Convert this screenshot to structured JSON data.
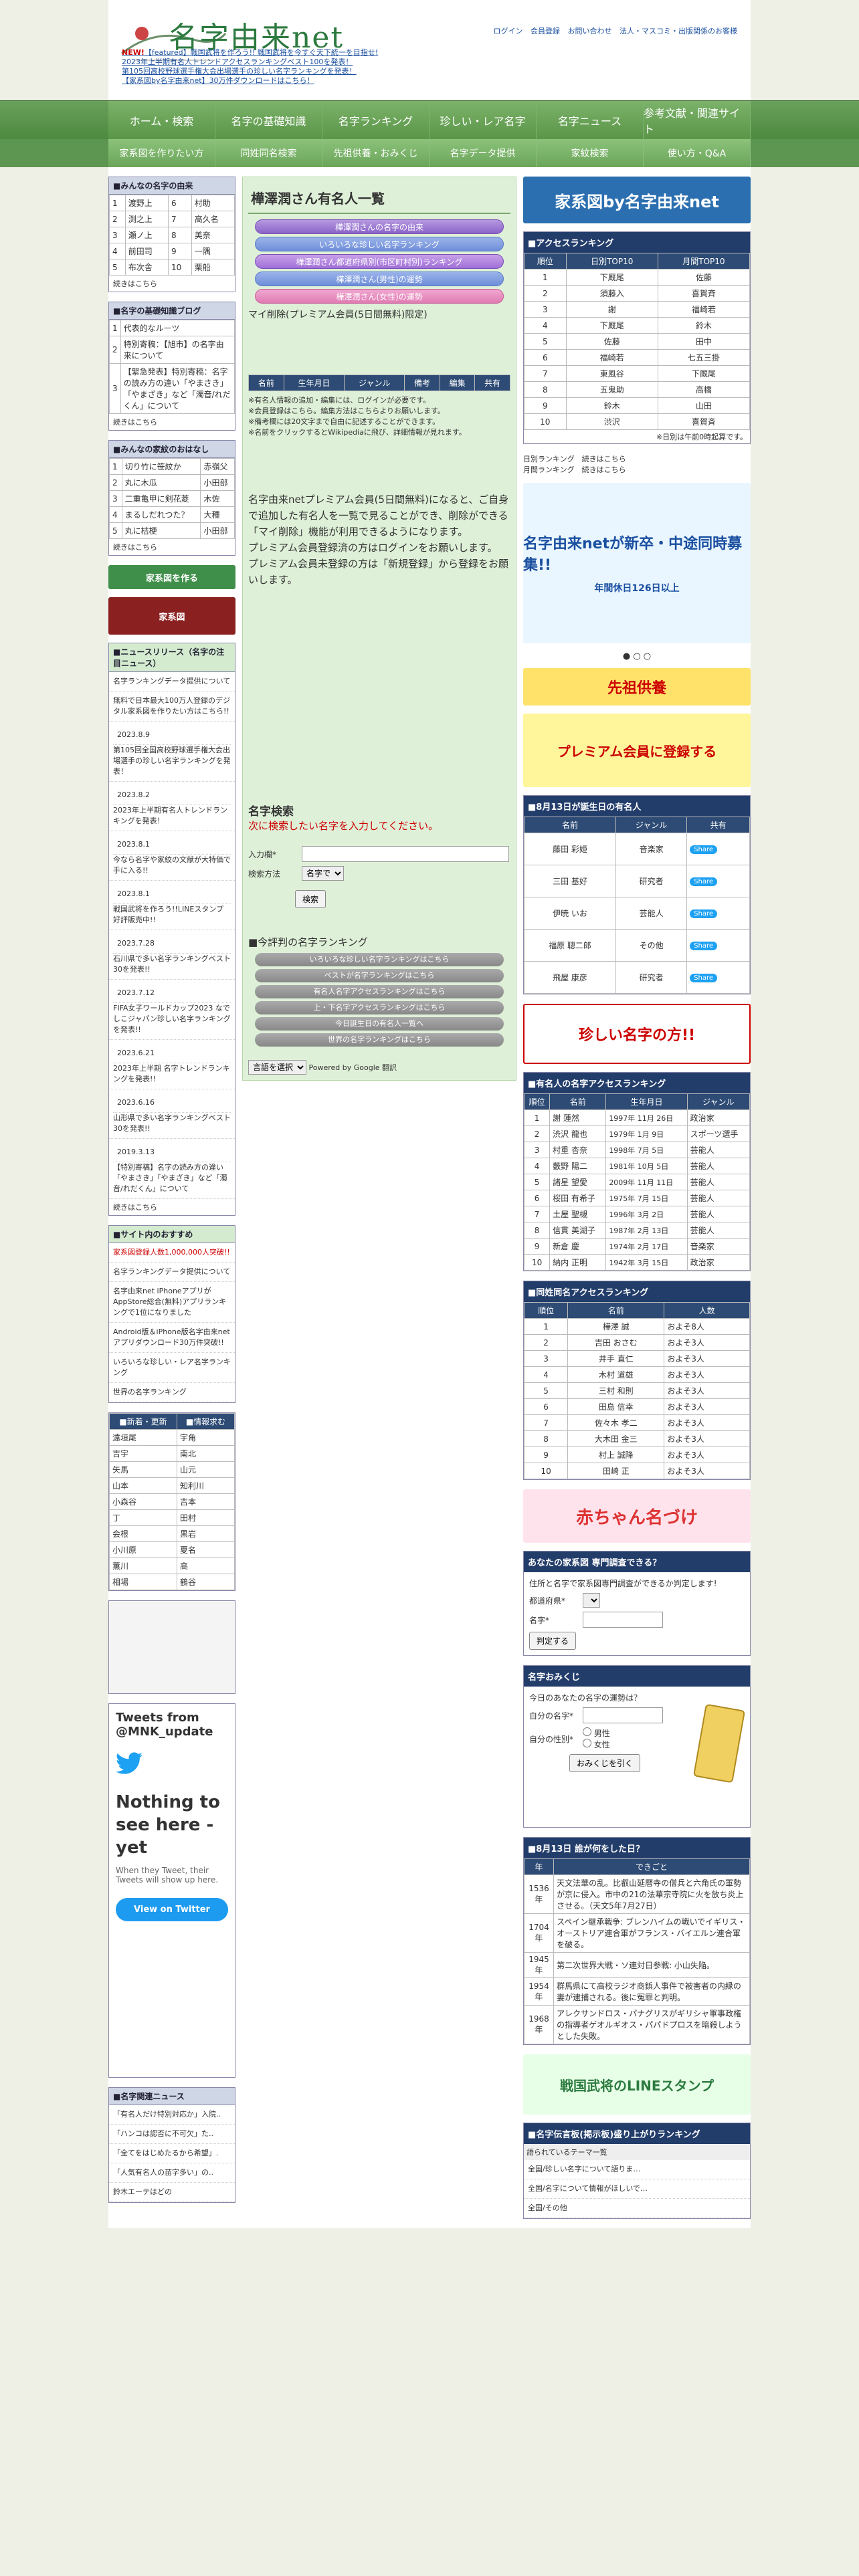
{
  "header": {
    "logo": "名字由来net",
    "links": [
      "ログイン",
      "会員登録",
      "お問い合わせ",
      "法人・マスコミ・出版関係のお客様"
    ],
    "news": [
      {
        "new": "NEW!",
        "text": "【featured】戦国武将を作ろう!! 戦国武将を今すぐ天下統一を目指せ!"
      },
      {
        "new": "",
        "text": "2023年上半期有名人トレンドアクセスランキングベスト100を発表！"
      },
      {
        "new": "",
        "text": "第105回高校野球選手権大会出場選手の珍しい名字ランキングを発表！"
      },
      {
        "new": "",
        "text": "【家系図by名字由来net】30万件ダウンロードはこちら！"
      }
    ]
  },
  "nav": [
    "ホーム・検索",
    "名字の基礎知識",
    "名字ランキング",
    "珍しい・レア名字",
    "名字ニュース",
    "参考文献・関連サイト"
  ],
  "subnav": [
    "家系図を作りたい方",
    "同姓同名検索",
    "先祖供養・おみくじ",
    "名字データ提供",
    "家紋検索",
    "使い方・Q&A"
  ],
  "left": {
    "surname_box_title": "■みんなの名字の由来",
    "surnames": [
      [
        "1",
        "渡野上",
        "6",
        "村助"
      ],
      [
        "2",
        "渕之上",
        "7",
        "高久名"
      ],
      [
        "3",
        "瀬ノ上",
        "8",
        "美奈"
      ],
      [
        "4",
        "前田司",
        "9",
        "一隅"
      ],
      [
        "5",
        "布次舎",
        "10",
        "栗船"
      ]
    ],
    "more": "続きはこちら",
    "basics_title": "■名字の基礎知識ブログ",
    "basics": [
      [
        "1",
        "代表的なルーツ"
      ],
      [
        "2",
        "特別寄稿：【旭市】の名字由来について"
      ],
      [
        "3",
        "【緊急発表】特別寄稿：名字の読み方の違い「やまさき」「やまざき」など「濁音/れだくん」について"
      ]
    ],
    "kamon_title": "■みんなの家紋のおはなし",
    "kamon": [
      [
        "1",
        "切り竹に笹紋か",
        "赤嶺父"
      ],
      [
        "2",
        "丸に木瓜",
        "小田部"
      ],
      [
        "3",
        "二重亀甲に剣花菱",
        "木佐"
      ],
      [
        "4",
        "まるしだれつた？",
        "大種"
      ],
      [
        "5",
        "丸に桔梗",
        "小田部"
      ]
    ],
    "news_title": "■ニュースリリース（名字の注目ニュース）",
    "news_items": [
      {
        "date": "",
        "text": "名字ランキングデータ提供について"
      },
      {
        "date": "",
        "text": "無料で日本最大100万人登録のデジタル家系図を作りたい方はこちら!!"
      },
      {
        "date": "2023.8.9",
        "text": "第105回全国高校野球選手権大会出場選手の珍しい名字ランキングを発表！"
      },
      {
        "date": "2023.8.2",
        "text": "2023年上半期有名人トレンドランキングを発表！"
      },
      {
        "date": "2023.8.1",
        "text": "今なら名字や家紋の文献が大特価で手に入る!!"
      },
      {
        "date": "2023.8.1",
        "text": "戦国武将を作ろう!!LINEスタンプ　好評販売中!!"
      },
      {
        "date": "2023.7.28",
        "text": "石川県で多い名字ランキングベスト30を発表!!"
      },
      {
        "date": "2023.7.12",
        "text": "FIFA女子ワールドカップ2023 なでしこジャパン珍しい名字ランキングを発表!!"
      },
      {
        "date": "2023.6.21",
        "text": "2023年上半期 名字トレンドランキングを発表!!"
      },
      {
        "date": "2023.6.16",
        "text": "山形県で多い名字ランキングベスト30を発表!!"
      },
      {
        "date": "2019.3.13",
        "text": "【特別寄稿】名字の読み方の違い「やまさき」「やまざき」など「濁音/れだくん」について"
      }
    ],
    "site_title": "■サイト内のおすすめ",
    "site_items": [
      "家系図登録人数1,000,000人突破!!",
      "名字ランキングデータ提供について",
      "名字由来net iPhoneアプリがAppStore総合(無料)アプリランキングで1位になりました",
      "Android版＆iPhone版名字由来netアプリダウンロード30万件突破!!",
      "いろいろな珍しい・レア名字ランキング",
      "世界の名字ランキング"
    ],
    "new_title1": "■新着・更新",
    "new_title2": "■情報求む",
    "new_rows": [
      [
        "遠垣尾",
        "宇角"
      ],
      [
        "吉宇",
        "南北"
      ],
      [
        "矢馬",
        "山元"
      ],
      [
        "山本",
        "知利川"
      ],
      [
        "小森谷",
        "吉本"
      ],
      [
        "丁",
        "田村"
      ],
      [
        "会根",
        "黒岩"
      ],
      [
        "小川原",
        "夏名"
      ],
      [
        "薫川",
        "高"
      ],
      [
        "相場",
        "鶴谷"
      ]
    ],
    "twitter_title": "Tweets from @MNK_update",
    "twitter_empty": "Nothing to see here - yet",
    "twitter_sub": "When they Tweet, their Tweets will show up here.",
    "twitter_btn": "View on Twitter",
    "related_title": "■名字関連ニュース",
    "related": [
      "「有名人だけ特別対応か」入院..",
      "「ハンコは認否に不可欠」た..",
      "「全てをはじめたるから希望」.",
      "「人気有名人の苗字多い」の..",
      "鈴木エーテはどの"
    ]
  },
  "main": {
    "title": "樺澤潤さん有名人一覧",
    "pills": [
      "樺澤潤さんの名字の由来",
      "いろいろな珍しい名字ランキング",
      "樺澤潤さん都道府県別(市区町村別)ランキング",
      "樺澤潤さん(男性)の運勢",
      "樺澤潤さん(女性)の運勢"
    ],
    "delete_link": "マイ削除(プレミアム会員(5日間無料)限定)",
    "table_headers": [
      "名前",
      "生年月日",
      "ジャンル",
      "備考",
      "編集",
      "共有"
    ],
    "notes": [
      "※有名人情報の追加・編集には、ログインが必要です。",
      "※会員登録はこちら。編集方法はこちらよりお願いします。",
      "※備考欄には20文字まで自由に記述することができます。",
      "※名前をクリックするとWikipediaに飛び、詳細情報が見れます。"
    ],
    "premium_text": "名字由来netプレミアム会員(5日間無料)になると、ご自身で追加した有名人を一覧で見ることができ、削除ができる「マイ削除」機能が利用できるようになります。",
    "premium_login": "プレミアム会員登録済の方はログインをお願いします。",
    "premium_register": "プレミアム会員未登録の方は「新規登録」から登録をお願いします。",
    "search_title": "名字検索",
    "search_prompt": "次に検索したい名字を入力してください。",
    "search_label": "入力欄*",
    "method_label": "検索方法",
    "method_value": "名字で",
    "search_btn": "検索",
    "rank_title": "■今評判の名字ランキング",
    "rank_pills": [
      "いろいろな珍しい名字ランキングはこちら",
      "ベストが名字ランキングはこちら",
      "有名人名字アクセスランキングはこちら",
      "上・下名字アクセスランキングはこちら",
      "今日誕生日の有名人一覧へ",
      "世界の名字ランキングはこちら"
    ],
    "lang_select": "言語を選択",
    "powered": "Powered by Google 翻訳"
  },
  "right": {
    "access_title": "■アクセスランキング",
    "access_headers": [
      "順位",
      "日別TOP10",
      "月間TOP10"
    ],
    "access_rows": [
      [
        "1",
        "下厩尾",
        "佐藤"
      ],
      [
        "2",
        "須藤入",
        "喜賀斉"
      ],
      [
        "3",
        "謝",
        "福崎若"
      ],
      [
        "4",
        "下厩尾",
        "鈴木"
      ],
      [
        "5",
        "佐藤",
        "田中"
      ],
      [
        "6",
        "福崎若",
        "七五三掛"
      ],
      [
        "7",
        "東風谷",
        "下厩尾"
      ],
      [
        "8",
        "五鬼助",
        "高橋"
      ],
      [
        "9",
        "鈴木",
        "山田"
      ],
      [
        "10",
        "渋沢",
        "喜賀斉"
      ]
    ],
    "access_note": "※日別は午前0時起算です。",
    "daily_link": "日別ランキング　続きはこちら",
    "monthly_link": "月間ランキング　続きはこちら",
    "ad_title": "名字由来netが新卒・中途同時募集!!",
    "ad_sub": "年間休日126日以上",
    "bday_title": "■8月13日が誕生日の有名人",
    "bday_headers": [
      "名前",
      "ジャンル",
      "共有"
    ],
    "bday_rows": [
      [
        "藤田 彩姫",
        "音楽家"
      ],
      [
        "三田 基好",
        "研究者"
      ],
      [
        "伊暁 いお",
        "芸能人"
      ],
      [
        "福原 聰二郎",
        "その他"
      ],
      [
        "飛屋 康彦",
        "研究者"
      ]
    ],
    "rare_banner": "珍しい名字の方!!",
    "famous_title": "■有名人の名字アクセスランキング",
    "famous_headers": [
      "順位",
      "名前",
      "生年月日",
      "ジャンル"
    ],
    "famous_rows": [
      [
        "1",
        "謝 蓮然",
        "1997年 11月 26日",
        "政治家"
      ],
      [
        "2",
        "渋沢 龍也",
        "1979年 1月 9日",
        "スポーツ選手"
      ],
      [
        "3",
        "村重 杏奈",
        "1998年 7月 5日",
        "芸能人"
      ],
      [
        "4",
        "藪野 陽二",
        "1981年 10月 5日",
        "芸能人"
      ],
      [
        "5",
        "諸星 望愛",
        "2009年 11月 11日",
        "芸能人"
      ],
      [
        "6",
        "桜田 有希子",
        "1975年 7月 15日",
        "芸能人"
      ],
      [
        "7",
        "土屋 聖槻",
        "1996年 3月 2日",
        "芸能人"
      ],
      [
        "8",
        "信貫 美湖子",
        "1987年 2月 13日",
        "芸能人"
      ],
      [
        "9",
        "新倉 慶",
        "1974年 2月 17日",
        "音楽家"
      ],
      [
        "10",
        "納内 正明",
        "1942年 3月 15日",
        "政治家"
      ]
    ],
    "samename_title": "■同姓同名アクセスランキング",
    "samename_headers": [
      "順位",
      "名前",
      "人数"
    ],
    "samename_rows": [
      [
        "1",
        "樺澤 誠",
        "およそ8人"
      ],
      [
        "2",
        "吉田 おさむ",
        "およそ3人"
      ],
      [
        "3",
        "井手 直仁",
        "およそ3人"
      ],
      [
        "4",
        "木村 道雄",
        "およそ3人"
      ],
      [
        "5",
        "三村 和則",
        "およそ3人"
      ],
      [
        "6",
        "田島 信幸",
        "およそ3人"
      ],
      [
        "7",
        "佐々木 孝二",
        "およそ3人"
      ],
      [
        "8",
        "大木田 金三",
        "およそ3人"
      ],
      [
        "9",
        "村上 誠降",
        "およそ3人"
      ],
      [
        "10",
        "田崎 正",
        "およそ3人"
      ]
    ],
    "baby_banner": "赤ちゃん名づけ",
    "kakeizu_title": "あなたの家系図 専門調査できる？",
    "kakeizu_text": "住所と名字で家系図専門調査ができるか判定します!",
    "pref_label": "都道府県*",
    "name_label": "名字*",
    "judge_btn": "判定する",
    "omikuji_title": "名字おみくじ",
    "omikuji_text": "今日のあなたの名字の運勢は？",
    "omikuji_name": "自分の名字*",
    "omikuji_gender": "自分の性別*",
    "male": "男性",
    "female": "女性",
    "omikuji_btn": "おみくじを引く",
    "history_title": "■8月13日 誰が何をした日？",
    "history_headers": [
      "年",
      "できごと"
    ],
    "history_rows": [
      [
        "1536年",
        "天文法華の乱。比叡山延暦寺の僧兵と六角氏の軍勢が京に侵入。市中の21の法華宗寺院に火を放ち炎上させる。（天文5年7月27日）"
      ],
      [
        "1704年",
        "スペイン継承戦争: ブレンハイムの戦いでイギリス・オーストリア連合軍がフランス・バイエルン連合軍を破る。"
      ],
      [
        "1945年",
        "第二次世界大戦・ソ連対日参戦: 小山失陥。"
      ],
      [
        "1954年",
        "群馬県にて高校ラジオ商鋲人事件で被害者の内縁の妻が逮捕される。後に冤罪と判明。"
      ],
      [
        "1968年",
        "アレクサンドロス・パナグリスがギリシャ軍事政権の指導者ゲオルギオス・パパドプロスを暗殺しようとした失敗。"
      ]
    ],
    "line_banner": "戦国武将のLINEスタンプ",
    "board_title": "■名字伝言板(掲示板)盛り上がりランキング",
    "board_sub": "語られているテーマ一覧",
    "board_items": [
      "全国/珍しい名字について語りま…",
      "全国/名字について情報がほしいで…",
      "全国/その他"
    ]
  }
}
